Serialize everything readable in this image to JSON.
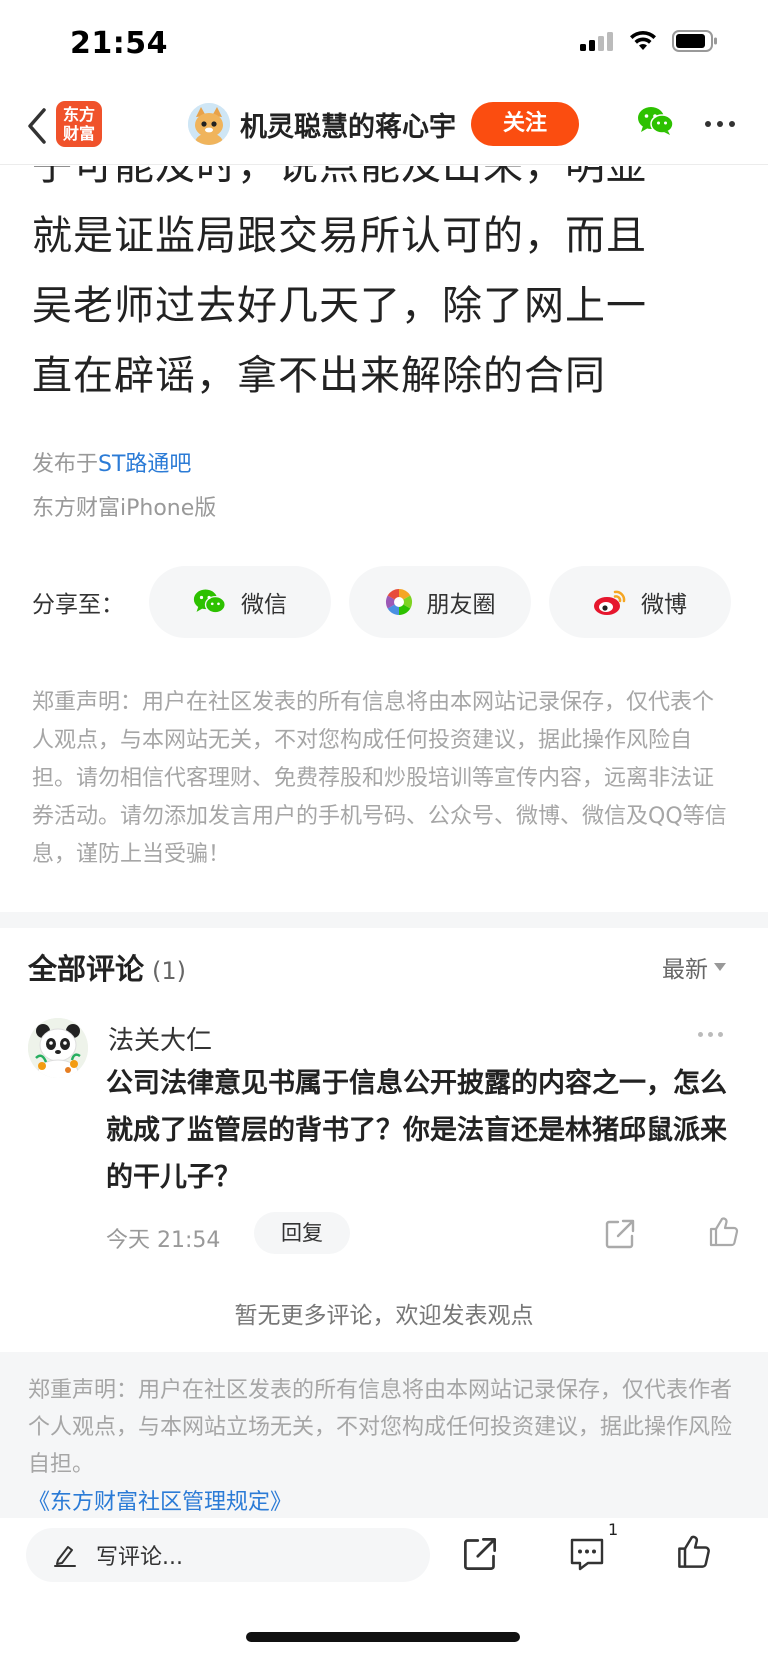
{
  "status_bar": {
    "time": "21:54"
  },
  "nav": {
    "logo_text_line1": "东方",
    "logo_text_line2": "财富",
    "author_name": "机灵聪慧的蒋心宇",
    "follow_label": "关注"
  },
  "article": {
    "clipped_line": "子可能及时，说点能及出来，明显",
    "lines": [
      "就是证监局跟交易所认可的，而且",
      "吴老师过去好几天了，除了网上一",
      "直在辟谣，拿不出来解除的合同"
    ],
    "published_prefix": "发布于",
    "published_bar": "ST路通吧",
    "client": "东方财富iPhone版"
  },
  "share": {
    "label": "分享至：",
    "wechat": "微信",
    "moments": "朋友圈",
    "weibo": "微博"
  },
  "disclaimer_top": "郑重声明：用户在社区发表的所有信息将由本网站记录保存，仅代表个人观点，与本网站无关，不对您构成任何投资建议，据此操作风险自担。请勿相信代客理财、免费荐股和炒股培训等宣传内容，远离非法证券活动。请勿添加发言用户的手机号码、公众号、微博、微信及QQ等信息，谨防上当受骗！",
  "comments": {
    "title": "全部评论",
    "count": "(1)",
    "sort_label": "最新",
    "items": [
      {
        "user": "法关大仁",
        "text": "公司法律意见书属于信息公开披露的内容之一，怎么就成了监管层的背书了？你是法盲还是林猪邱鼠派来的干儿子？",
        "time": "今天 21:54",
        "reply_label": "回复"
      }
    ],
    "no_more": "暂无更多评论，欢迎发表观点"
  },
  "footer": {
    "disclaimer": "郑重声明：用户在社区发表的所有信息将由本网站记录保存，仅代表作者个人观点，与本网站立场无关，不对您构成任何投资建议，据此操作风险自担。",
    "rules_link": "《东方财富社区管理规定》"
  },
  "bottom_bar": {
    "input_placeholder": "写评论...",
    "comment_count": "1"
  },
  "colors": {
    "accent_orange": "#fb4d10",
    "link_blue": "#2b7bd6",
    "logo_red": "#f0522b",
    "wechat_green": "#2dc100",
    "weibo_red": "#e6162d"
  }
}
